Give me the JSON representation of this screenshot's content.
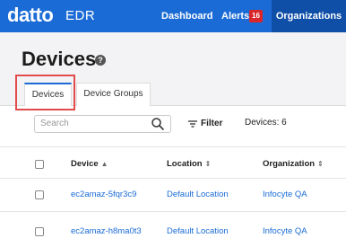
{
  "header": {
    "logo": "datto",
    "product": "EDR",
    "nav": [
      {
        "label": "Dashboard"
      },
      {
        "label": "Alerts",
        "badge": "16"
      },
      {
        "label": "Organizations"
      }
    ]
  },
  "page": {
    "title": "Devices",
    "help_glyph": "?"
  },
  "tabs": [
    {
      "label": "Devices",
      "active": true
    },
    {
      "label": "Device Groups",
      "active": false
    }
  ],
  "toolbar": {
    "search_placeholder": "Search",
    "filter_label": "Filter",
    "device_count": "Devices: 6"
  },
  "table": {
    "columns": [
      "Device",
      "Location",
      "Organization"
    ],
    "rows": [
      {
        "device": "ec2amaz-5fqr3c9",
        "location": "Default Location",
        "organization": "Infocyte QA"
      },
      {
        "device": "ec2amaz-h8ma0t3",
        "location": "Default Location",
        "organization": "Infocyte QA"
      }
    ]
  },
  "colors": {
    "brand_blue": "#1a6bd6",
    "alert_red": "#d9262b",
    "highlight_red": "#e04b4b"
  }
}
